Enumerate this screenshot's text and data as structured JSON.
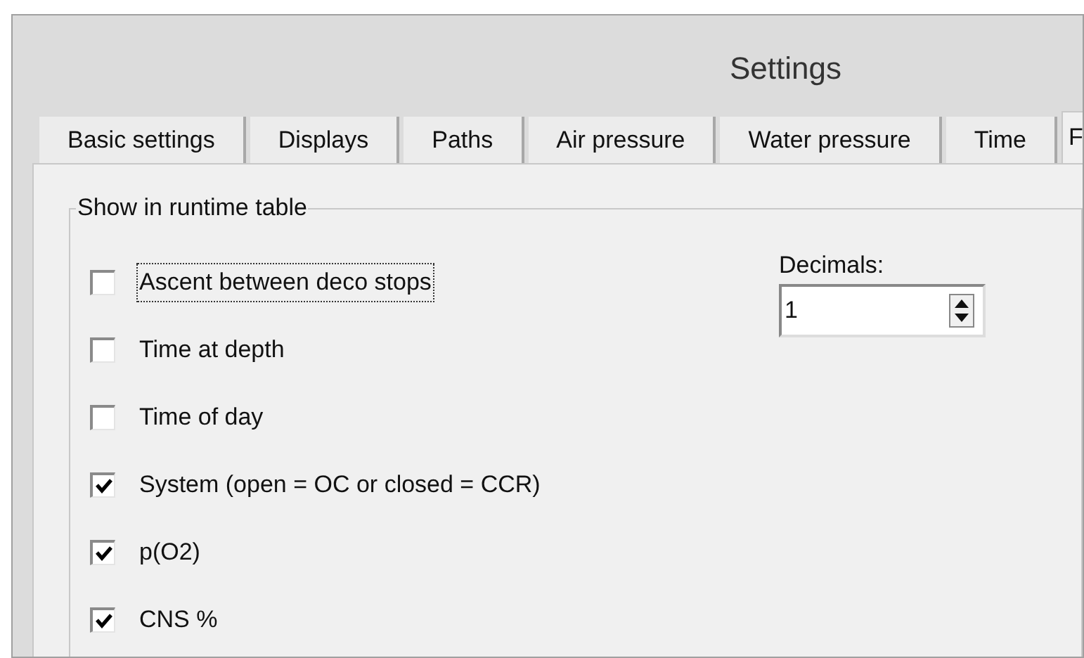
{
  "window": {
    "title": "Settings"
  },
  "tabs": [
    {
      "label": "Basic settings",
      "selected": false
    },
    {
      "label": "Displays",
      "selected": false
    },
    {
      "label": "Paths",
      "selected": false
    },
    {
      "label": "Air pressure",
      "selected": false
    },
    {
      "label": "Water pressure",
      "selected": false
    },
    {
      "label": "Time",
      "selected": false
    },
    {
      "label": "F",
      "selected": true
    }
  ],
  "group": {
    "title": "Show in runtime table",
    "options": [
      {
        "label": "Ascent between deco stops",
        "checked": false,
        "focused": true
      },
      {
        "label": "Time at depth",
        "checked": false,
        "focused": false
      },
      {
        "label": "Time of day",
        "checked": false,
        "focused": false
      },
      {
        "label": "System (open = OC or closed = CCR)",
        "checked": true,
        "focused": false
      },
      {
        "label": "p(O2)",
        "checked": true,
        "focused": false
      },
      {
        "label": "CNS %",
        "checked": true,
        "focused": false
      }
    ],
    "decimals": {
      "label": "Decimals:",
      "value": "1"
    }
  }
}
